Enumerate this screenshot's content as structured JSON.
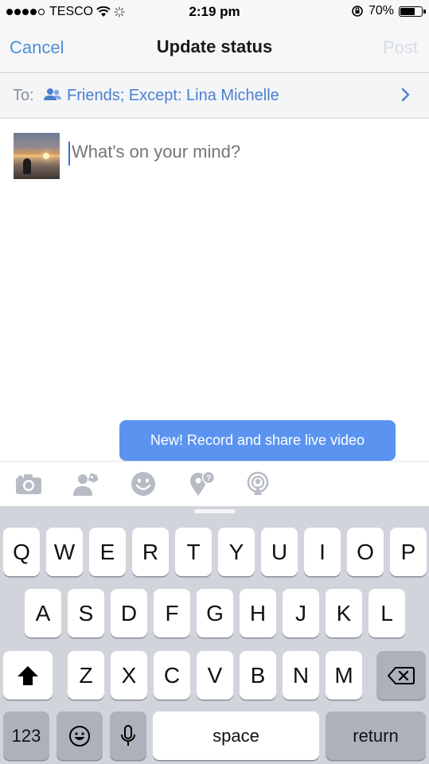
{
  "status_bar": {
    "carrier": "TESCO",
    "time": "2:19 pm",
    "battery": "70%",
    "battery_level": 0.7
  },
  "nav": {
    "cancel": "Cancel",
    "title": "Update status",
    "post": "Post"
  },
  "audience": {
    "to_label": "To:",
    "value": "Friends; Except: Lina Michelle"
  },
  "composer": {
    "placeholder": "What's on your mind?"
  },
  "tooltip": {
    "text": "New! Record and share live video"
  },
  "actions": [
    {
      "icon": "camera-icon"
    },
    {
      "icon": "tag-people-icon"
    },
    {
      "icon": "emoji-icon"
    },
    {
      "icon": "checkin-icon"
    },
    {
      "icon": "live-video-icon"
    }
  ],
  "keyboard": {
    "row1": [
      "Q",
      "W",
      "E",
      "R",
      "T",
      "Y",
      "U",
      "I",
      "O",
      "P"
    ],
    "row2": [
      "A",
      "S",
      "D",
      "F",
      "G",
      "H",
      "J",
      "K",
      "L"
    ],
    "row3": [
      "Z",
      "X",
      "C",
      "V",
      "B",
      "N",
      "M"
    ],
    "numbers": "123",
    "space": "space",
    "return": "return"
  },
  "colors": {
    "accent": "#4a90d9",
    "tooltip": "#5b93f0",
    "post_disabled": "#d7dde6"
  }
}
